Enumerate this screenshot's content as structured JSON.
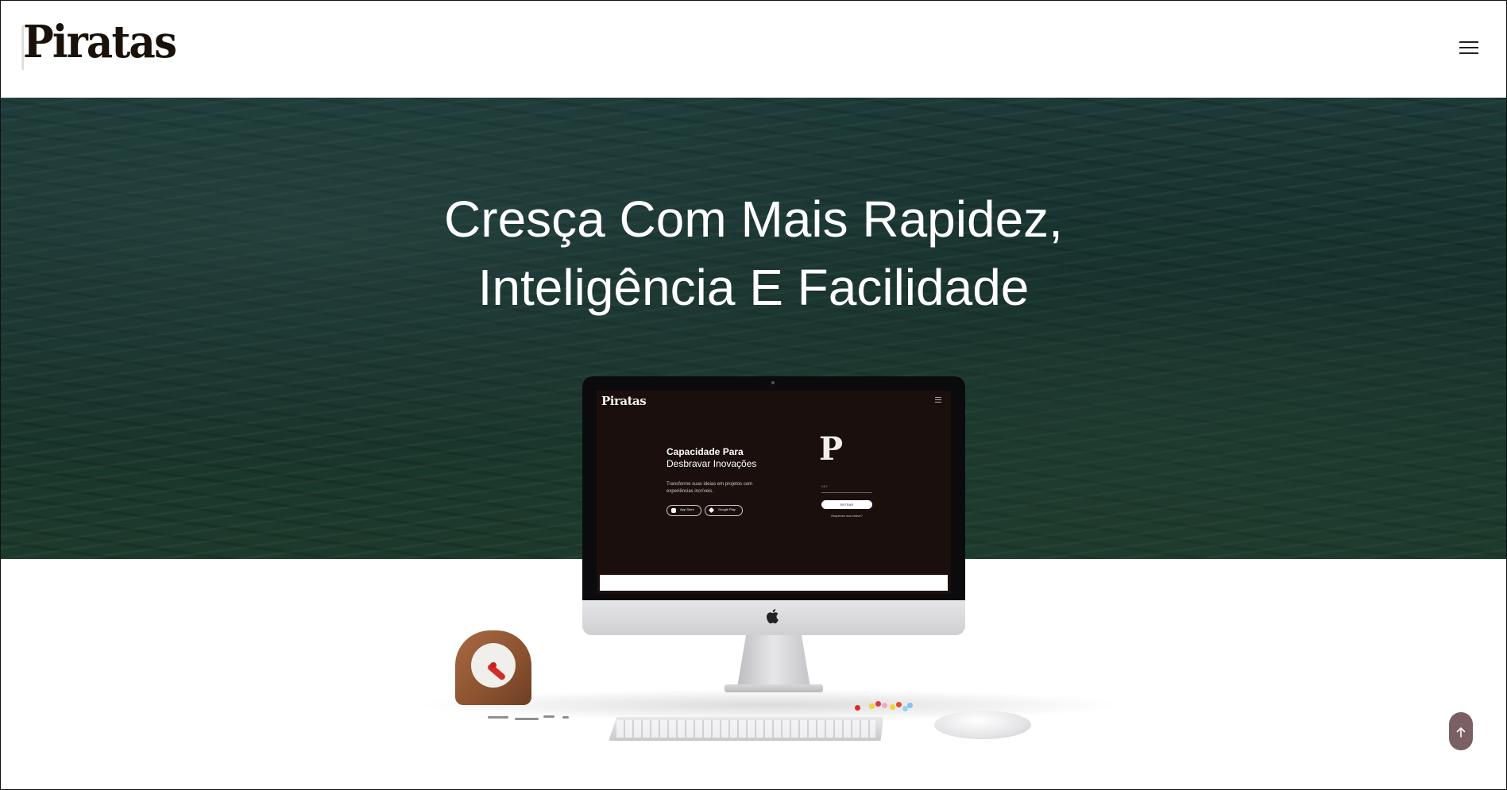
{
  "header": {
    "logo_text": "Piratas",
    "menu_icon": "hamburger-menu-icon"
  },
  "hero": {
    "title_line1": "Cresça Com Mais Rapidez,",
    "title_line2": "Inteligência E Facilidade"
  },
  "device_screen": {
    "logo_text": "Piratas",
    "heading_bold": "Capacidade Para",
    "heading_regular": "Desbravar Inovações",
    "paragraph": "Transforme suas ideias em projetos com experiências incríveis.",
    "store_apple_label": "App Store",
    "store_google_label": "Google Play",
    "brand_mark": "P",
    "field_label": "KEY",
    "button_label": "ENTRAR",
    "link_label": "Esqueceu sua chave?"
  },
  "scroll_top": {
    "icon": "arrow-up-icon"
  },
  "colors": {
    "hero_bg": "#16302c",
    "screen_bg": "#1b0f0e",
    "scroll_btn": "#7a5f63"
  }
}
